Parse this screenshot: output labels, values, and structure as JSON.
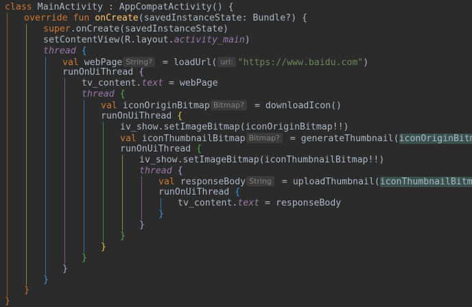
{
  "code": {
    "l1": {
      "kw": "class",
      "name": "MainActivity",
      "colon": " : ",
      "parent": "AppCompatActivity",
      "tail": "() {"
    },
    "l2": {
      "kw": "override fun",
      "fn": "onCreate",
      "tail": "(savedInstanceState: Bundle?) {"
    },
    "l3": {
      "kw": "super",
      "tail": ".onCreate(savedInstanceState)"
    },
    "l4": {
      "head": "setContentView(R.layout.",
      "ital": "activity_main",
      "tail": ")"
    },
    "l5": {
      "ital": "thread",
      "brace": " {"
    },
    "l6": {
      "kw": "val",
      "name": " webPage",
      "hint": "String?",
      "eq": " = loadUrl(",
      "hint2": "url:",
      "str": "\"https://www.baidu.com\"",
      "tail": ")"
    },
    "l7": {
      "head": "runOnUiThread",
      "brace": " {"
    },
    "l8": {
      "head": "tv_content.",
      "ital": "text",
      "tail": " = webPage"
    },
    "l9": {
      "ital": "thread",
      "brace": " {"
    },
    "l10": {
      "kw": "val",
      "name": " iconOriginBitmap",
      "hint": "Bitmap?",
      "tail": " = downloadIcon()"
    },
    "l11": {
      "head": "runOnUiThread",
      "brace": " {"
    },
    "l12": {
      "head": "iv_show.setImageBitmap(iconOriginBitmap!!)"
    },
    "l13": {
      "kw": "val",
      "name": " iconThumbnailBitmap",
      "hint": "Bitmap?",
      "eq": " = generateThumbnail(",
      "hl": "iconOriginBitmap",
      "tail": ")"
    },
    "l14": {
      "head": "runOnUiThread",
      "brace": " {"
    },
    "l15": {
      "head": "iv_show.setImageBitmap(iconThumbnailBitmap!!)"
    },
    "l16": {
      "ital": "thread",
      "brace": " {"
    },
    "l17": {
      "kw": "val",
      "name": " responseBody",
      "hint": "String",
      "eq": " = uploadThumbnail(",
      "hl": "iconThumbnailBitmap",
      "tail": ")"
    },
    "l18": {
      "head": "runOnUiThread",
      "brace": " {"
    },
    "l19": {
      "head": "tv_content.",
      "ital": "text",
      "tail": " = responseBody"
    },
    "closing_brace": "}"
  },
  "colors": {
    "background": "#2b2b2b",
    "keyword": "#cc7832",
    "function": "#ffc66d",
    "string": "#6a8759",
    "property_italic": "#9876aa",
    "text": "#a9b7c6",
    "inlay_hint_bg": "#3b3b3b"
  }
}
